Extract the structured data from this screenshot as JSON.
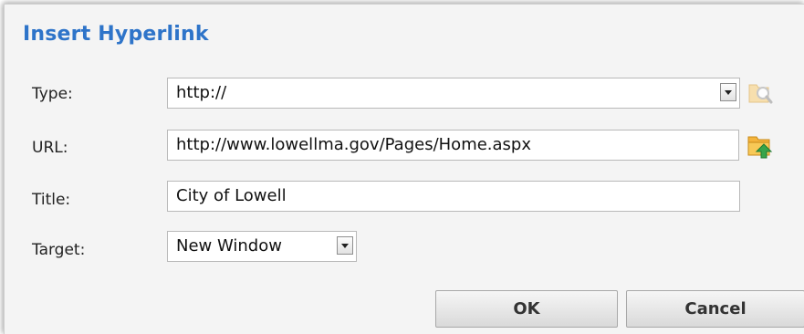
{
  "dialog": {
    "title": "Insert Hyperlink"
  },
  "form": {
    "type_label": "Type:",
    "type_value": "http://",
    "url_label": "URL:",
    "url_value": "http://www.lowellma.gov/Pages/Home.aspx",
    "title_label": "Title:",
    "title_value": "City of Lowell",
    "target_label": "Target:",
    "target_value": "New Window"
  },
  "icons": {
    "browse": "magnifier-folder-icon",
    "upload": "folder-upload-icon"
  },
  "buttons": {
    "ok": "OK",
    "cancel": "Cancel"
  },
  "colors": {
    "title": "#2e74c9",
    "dialog_bg": "#f4f4f4"
  }
}
